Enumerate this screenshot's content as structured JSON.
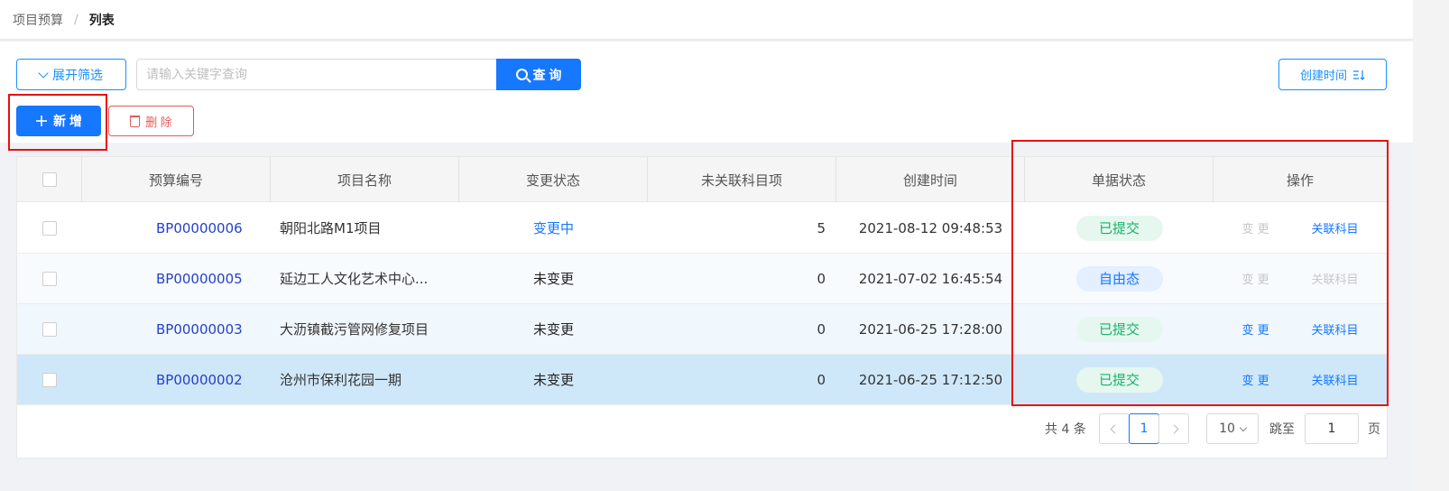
{
  "breadcrumb": {
    "parent": "项目预算",
    "separator": "/",
    "current": "列表"
  },
  "toolbar": {
    "expand_label": "展开筛选",
    "search_placeholder": "请输入关键字查询",
    "search_value": "",
    "search_button": "查 询",
    "sort_label": "创建时间",
    "add_label": "新 增",
    "delete_label": "删 除"
  },
  "table": {
    "columns": [
      "预算编号",
      "项目名称",
      "变更状态",
      "未关联科目项",
      "创建时间",
      "单据状态",
      "操作"
    ],
    "rows": [
      {
        "code": "BP00000006",
        "name": "朝阳北路M1项目",
        "change_status": "变更中",
        "unlinked": "5",
        "created": "2021-08-12 09:48:53",
        "doc_status": "已提交",
        "op_change": "变 更",
        "op_link": "关联科目"
      },
      {
        "code": "BP00000005",
        "name": "延边工人文化艺术中心...",
        "change_status": "未变更",
        "unlinked": "0",
        "created": "2021-07-02 16:45:54",
        "doc_status": "自由态",
        "op_change": "变 更",
        "op_link": "关联科目"
      },
      {
        "code": "BP00000003",
        "name": "大沥镇截污管网修复项目",
        "change_status": "未变更",
        "unlinked": "0",
        "created": "2021-06-25 17:28:00",
        "doc_status": "已提交",
        "op_change": "变 更",
        "op_link": "关联科目"
      },
      {
        "code": "BP00000002",
        "name": "沧州市保利花园一期",
        "change_status": "未变更",
        "unlinked": "0",
        "created": "2021-06-25 17:12:50",
        "doc_status": "已提交",
        "op_change": "变 更",
        "op_link": "关联科目"
      }
    ]
  },
  "pagination": {
    "total_label": "共 4 条",
    "current_page": "1",
    "page_size": "10",
    "jump_label": "跳至",
    "jump_value": "1",
    "page_unit": "页"
  },
  "colors": {
    "primary": "#1677ff",
    "danger": "#e45a5a",
    "success": "#17b26a",
    "highlight_box": "#e8100f"
  },
  "icons": [
    "chevron-down-icon",
    "search-icon",
    "sort-icon",
    "plus-icon",
    "trash-icon"
  ]
}
